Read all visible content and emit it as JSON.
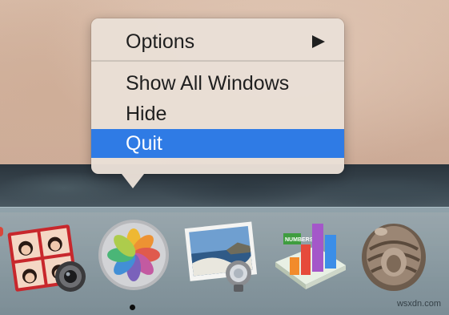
{
  "context_menu": {
    "items": [
      {
        "label": "Options",
        "has_submenu": true
      },
      {
        "label": "Show All Windows"
      },
      {
        "label": "Hide"
      },
      {
        "label": "Quit",
        "selected": true
      }
    ],
    "highlight_color": "#2f7be5"
  },
  "dock": {
    "apps": [
      {
        "name": "Photo Booth",
        "icon": "photo-booth-icon"
      },
      {
        "name": "Photos",
        "icon": "photos-icon",
        "running": true
      },
      {
        "name": "Preview",
        "icon": "preview-icon"
      },
      {
        "name": "Numbers",
        "icon": "numbers-icon",
        "label": "NUMBERS"
      },
      {
        "name": "Archive Utility",
        "icon": "archive-utility-icon"
      }
    ]
  },
  "watermark": "wsxdn.com"
}
